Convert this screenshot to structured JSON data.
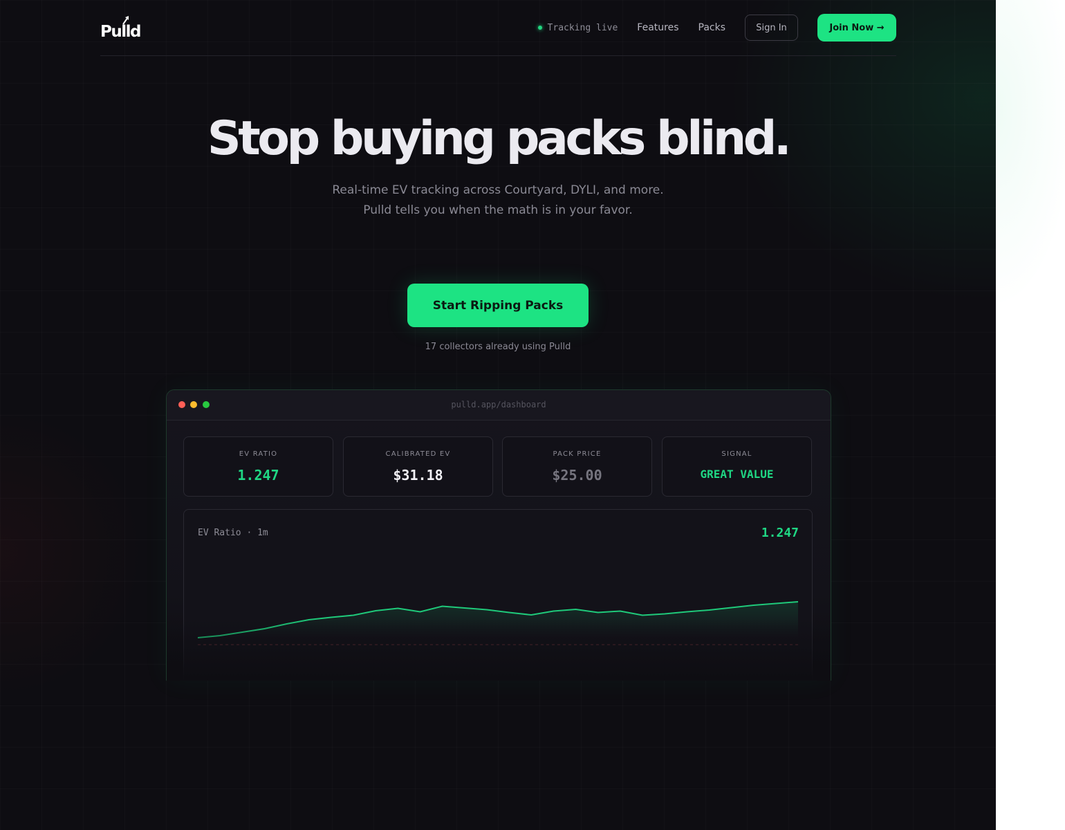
{
  "nav": {
    "logo": "Pulld",
    "status": "Tracking live",
    "links": [
      "Features",
      "Packs"
    ],
    "sign_in": "Sign In",
    "join": "Join Now →"
  },
  "hero": {
    "title": "Stop buying packs blind.",
    "subtitle_line1": "Real-time EV tracking across Courtyard, DYLI, and more.",
    "subtitle_line2": "Pulld tells you when the math is in your favor.",
    "cta": "Start Ripping Packs",
    "social_proof": "17 collectors already using Pulld"
  },
  "dashboard": {
    "url": "pulld.app/dashboard",
    "cards": [
      {
        "label": "EV RATIO",
        "value": "1.247",
        "color": "#1fd784"
      },
      {
        "label": "CALIBRATED EV",
        "value": "$31.18",
        "color": "#f2f1f6"
      },
      {
        "label": "PACK PRICE",
        "value": "$25.00",
        "color": "#76757f"
      },
      {
        "label": "SIGNAL",
        "value": "GREAT VALUE",
        "color": "#1fd784"
      }
    ],
    "chart": {
      "label": "EV Ratio · 1m",
      "current": "1.247"
    }
  },
  "colors": {
    "accent": "#1de383",
    "background": "#0e0d12",
    "traffic_lights": [
      "#ff5f57",
      "#febc2e",
      "#28c840"
    ]
  },
  "chart_data": {
    "type": "area",
    "series": [
      {
        "values": [
          1.0,
          1.006,
          1.016,
          1.026,
          1.04,
          1.052,
          1.059,
          1.065,
          1.078,
          1.085,
          1.075,
          1.091,
          1.086,
          1.081,
          1.073,
          1.066,
          1.077,
          1.082,
          1.073,
          1.077,
          1.065,
          1.069,
          1.075,
          1.08,
          1.087,
          1.094,
          1.099,
          1.104
        ]
      }
    ],
    "baseline": 1.0,
    "ylim": [
      0.95,
      1.25
    ]
  }
}
